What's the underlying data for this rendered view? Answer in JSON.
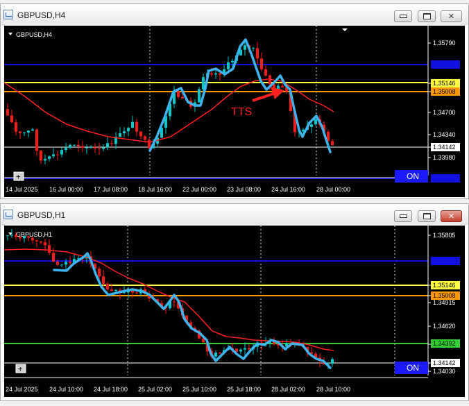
{
  "windows": [
    {
      "title": "GBPUSD,H4",
      "label": "GBPUSD,H4",
      "symbol_tag": "+",
      "on_label": "ON",
      "annotation": "TTS",
      "close_style": "normal",
      "price_scale": [
        "1.35790",
        "1.35146",
        "1.35008",
        "1.34700",
        "1.34340",
        "1.34142",
        "1.33980"
      ],
      "time_labels": [
        "14 Jul 2025",
        "16 Jul 00:00",
        "17 Jul 08:00",
        "18 Jul 16:00",
        "22 Jul 00:00",
        "23 Jul 08:00",
        "24 Jul 16:00",
        "28 Jul 00:00"
      ],
      "price_tags": [
        {
          "value": "1.35146",
          "bg": "#ffff40"
        },
        {
          "value": "1.35008",
          "bg": "#ff9900"
        },
        {
          "value": "1.34142",
          "bg": "#ffffff"
        }
      ]
    },
    {
      "title": "GBPUSD,H1",
      "label": "GBPUSD,H1",
      "symbol_tag": "+",
      "on_label": "ON",
      "annotation": "",
      "close_style": "red",
      "price_scale": [
        "1.35805",
        "1.35146",
        "1.35008",
        "1.34915",
        "1.34620",
        "1.34392",
        "1.34142",
        "1.34030"
      ],
      "time_labels": [
        "24 Jul 2025",
        "24 Jul 10:00",
        "24 Jul 18:00",
        "25 Jul 02:00",
        "25 Jul 10:00",
        "25 Jul 18:00",
        "28 Jul 02:00",
        "28 Jul 10:00"
      ],
      "price_tags": [
        {
          "value": "1.35146",
          "bg": "#ffff40"
        },
        {
          "value": "1.35008",
          "bg": "#ff9900"
        },
        {
          "value": "1.34392",
          "bg": "#33cc33"
        },
        {
          "value": "1.34142",
          "bg": "#ffffff"
        }
      ]
    }
  ],
  "colors": {
    "bull": "#00c8c8",
    "bear": "#ff1a1a",
    "ma": "#ff2020",
    "trace": "#3db4f0",
    "blue_level": "#1010e0",
    "yellow_level": "#ffff40",
    "orange_level": "#ff9900",
    "green_level": "#33cc33",
    "on_bg": "#1a1aff"
  }
}
